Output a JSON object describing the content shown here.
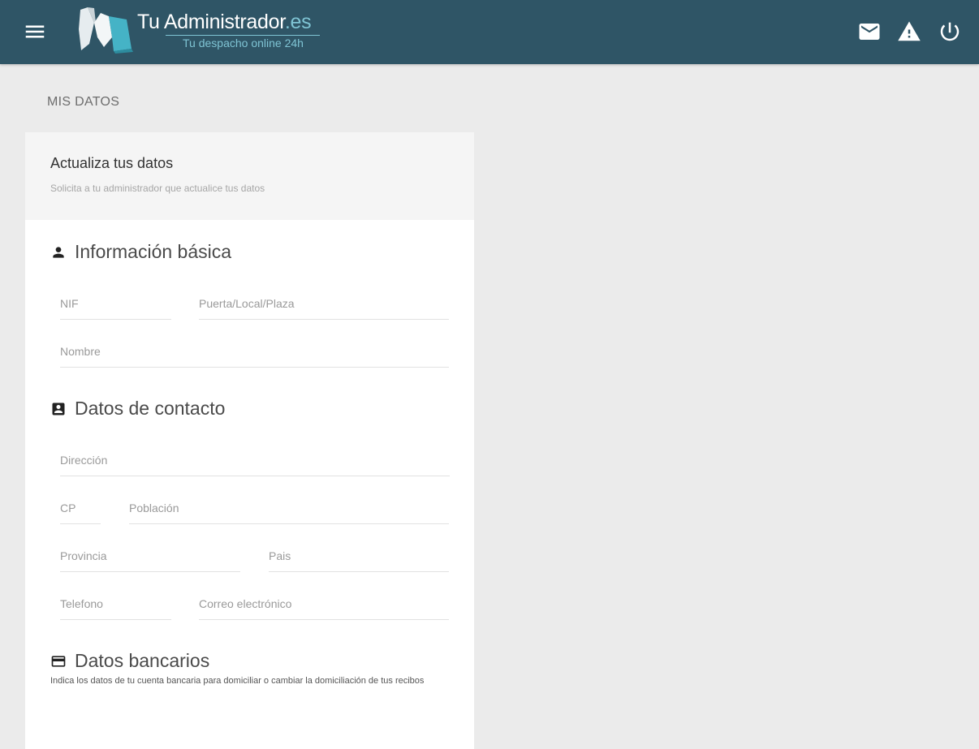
{
  "header": {
    "brand_title": "Tu Administrador",
    "brand_tld": ".es",
    "brand_tagline": "Tu despacho online 24h",
    "icons": [
      "menu-icon",
      "mail-icon",
      "warning-icon",
      "power-icon"
    ],
    "colors": {
      "bar": "#2f5566",
      "accent": "#7fc4d4"
    }
  },
  "page": {
    "title": "MIS DATOS"
  },
  "card": {
    "title": "Actualiza tus datos",
    "subtitle": "Solicita a tu administrador que actualice tus datos"
  },
  "sections": {
    "basic": {
      "title": "Información básica",
      "icon": "person-icon",
      "fields": {
        "nif": {
          "placeholder": "NIF",
          "value": ""
        },
        "door": {
          "placeholder": "Puerta/Local/Plaza",
          "value": ""
        },
        "name": {
          "placeholder": "Nombre",
          "value": ""
        }
      }
    },
    "contact": {
      "title": "Datos de contacto",
      "icon": "contact-card-icon",
      "fields": {
        "address": {
          "placeholder": "Dirección",
          "value": ""
        },
        "cp": {
          "placeholder": "CP",
          "value": ""
        },
        "town": {
          "placeholder": "Población",
          "value": ""
        },
        "province": {
          "placeholder": "Provincia",
          "value": ""
        },
        "country": {
          "placeholder": "Pais",
          "value": ""
        },
        "phone": {
          "placeholder": "Telefono",
          "value": ""
        },
        "email": {
          "placeholder": "Correo electrónico",
          "value": ""
        }
      }
    },
    "bank": {
      "title": "Datos bancarios",
      "icon": "credit-card-icon",
      "description": "Indica los datos de tu cuenta bancaria para domiciliar o cambiar la domiciliación de tus recibos"
    }
  }
}
